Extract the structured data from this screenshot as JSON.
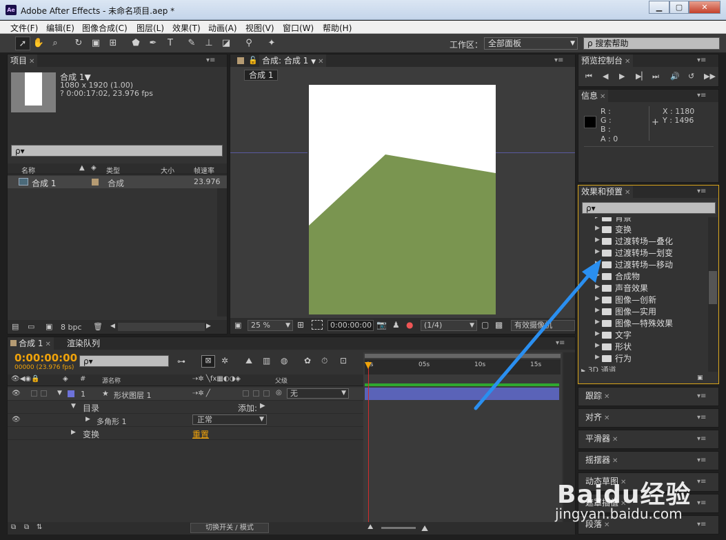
{
  "window": {
    "title": "Adobe After Effects - 未命名项目.aep *",
    "icon": "Ae",
    "min": "▁",
    "max": "▢",
    "close": "✕"
  },
  "menu": [
    "文件(F)",
    "编辑(E)",
    "图像合成(C)",
    "图层(L)",
    "效果(T)",
    "动画(A)",
    "视图(V)",
    "窗口(W)",
    "帮助(H)"
  ],
  "toolbar": {
    "workspace_label": "工作区：",
    "workspace_value": "全部面板",
    "search_help": "搜索帮助"
  },
  "project": {
    "tab": "项目",
    "comp_name": "合成 1▼",
    "comp_size": "1080 x 1920 (1.00)",
    "comp_dur": "? 0:00:17:02, 23.976 fps",
    "search_placeholder": "ρ▾",
    "cols": {
      "name": "名称",
      "type": "类型",
      "size": "大小",
      "fps": "帧速率"
    },
    "item": {
      "name": "合成 1",
      "type": "合成",
      "fps": "23.976"
    },
    "bpc": "8 bpc"
  },
  "comp": {
    "tab": "合成: 合成 1",
    "subtab": "合成 1",
    "zoom": "25 %",
    "timecode": "0:00:00:00",
    "res": "(1/4)",
    "camera": "有效摄像机"
  },
  "preview": {
    "tab": "预览控制台"
  },
  "info": {
    "tab": "信息",
    "r": "R :",
    "g": "G :",
    "b": "B :",
    "a": "A : 0",
    "x": "X : 1180",
    "y": "Y : 1496"
  },
  "effects": {
    "tab": "效果和预置",
    "search": "ρ▾",
    "items": [
      "背景",
      "变换",
      "过渡转场—叠化",
      "过渡转场—划变",
      "过渡转场—移动",
      "合成物",
      "声音效果",
      "图像—创新",
      "图像—实用",
      "图像—特殊效果",
      "文字",
      "形状",
      "行为"
    ],
    "bottom_item": "3D 通道"
  },
  "side_panels": [
    "跟踪",
    "对齐",
    "平滑器",
    "摇摆器",
    "动态草图",
    "遮罩插值",
    "段落"
  ],
  "timeline": {
    "tab": "合成 1",
    "tab2": "渲染队列",
    "time": "0:00:00:00",
    "frames": "00000 (23.976 fps)",
    "search": "ρ▾",
    "col_source": "源名称",
    "col_parent": "父级",
    "layer_num": "1",
    "layer_name": "形状图层 1",
    "parent": "无",
    "contents": "目录",
    "add": "添加:",
    "polygon": "多角形 1",
    "mode": "正常",
    "transform": "变换",
    "reset": "重置",
    "ruler": [
      "0s",
      "05s",
      "10s",
      "15s"
    ],
    "toggle": "切换开关 / 模式"
  },
  "watermark": {
    "text": "Baidu经验",
    "url": "jingyan.baidu.com"
  }
}
